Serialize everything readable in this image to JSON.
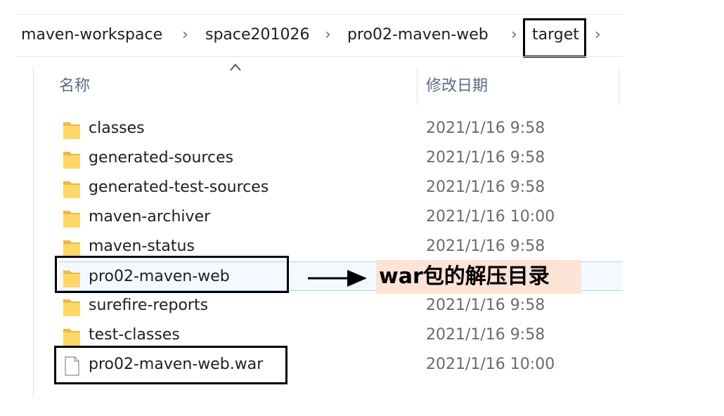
{
  "breadcrumb": {
    "items": [
      "maven-workspace",
      "space201026",
      "pro02-maven-web",
      "target"
    ],
    "separator": "›"
  },
  "columns": {
    "name": "名称",
    "modified": "修改日期"
  },
  "files": [
    {
      "name": "classes",
      "modified": "2021/1/16 9:58",
      "type": "folder"
    },
    {
      "name": "generated-sources",
      "modified": "2021/1/16 9:58",
      "type": "folder"
    },
    {
      "name": "generated-test-sources",
      "modified": "2021/1/16 9:58",
      "type": "folder"
    },
    {
      "name": "maven-archiver",
      "modified": "2021/1/16 10:00",
      "type": "folder"
    },
    {
      "name": "maven-status",
      "modified": "2021/1/16 9:58",
      "type": "folder"
    },
    {
      "name": "pro02-maven-web",
      "modified": "",
      "type": "folder"
    },
    {
      "name": "surefire-reports",
      "modified": "2021/1/16 9:58",
      "type": "folder"
    },
    {
      "name": "test-classes",
      "modified": "2021/1/16 9:58",
      "type": "folder"
    },
    {
      "name": "pro02-maven-web.war",
      "modified": "2021/1/16 10:00",
      "type": "file"
    }
  ],
  "annotation": {
    "text": "war包的解压目录"
  },
  "colors": {
    "folder": "#ffd766",
    "folder_shade": "#e9b94a",
    "selection": "#f4f9ff",
    "annotation_bg": "#fbe3d5"
  }
}
